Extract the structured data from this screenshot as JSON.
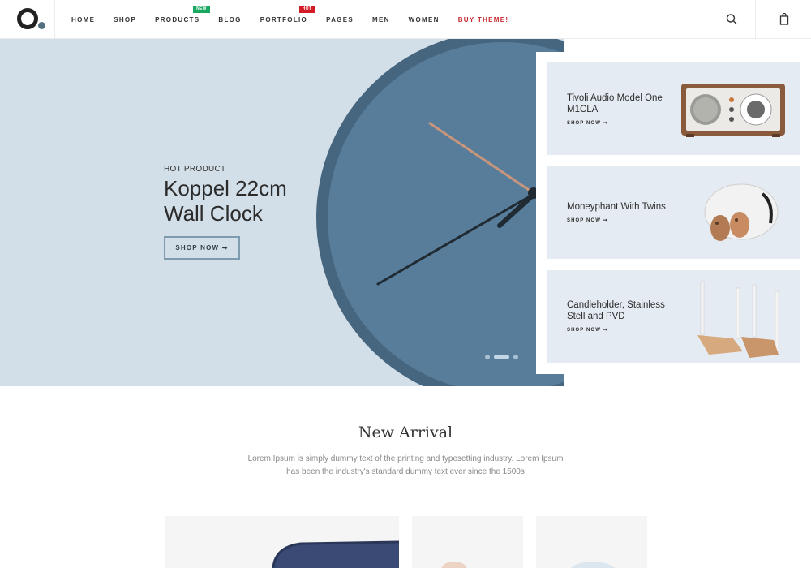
{
  "header": {
    "nav": [
      {
        "label": "HOME"
      },
      {
        "label": "SHOP"
      },
      {
        "label": "PRODUCTS",
        "badge": "NEW"
      },
      {
        "label": "BLOG"
      },
      {
        "label": "PORTFOLIO",
        "badge": "HOT"
      },
      {
        "label": "PAGES"
      },
      {
        "label": "MEN"
      },
      {
        "label": "WOMEN"
      },
      {
        "label": "BUY THEME!"
      }
    ],
    "icons": {
      "search": "search-icon",
      "cart": "shopping-bag-icon"
    }
  },
  "hero": {
    "kicker": "HOT PRODUCT",
    "title": "Koppel 22cm Wall Clock",
    "button": "SHOP NOW ➞",
    "slides": 3,
    "active_slide": 2
  },
  "side_banners": [
    {
      "title": "Tivoli Audio Model One M1CLA",
      "link": "SHOP NOW ➞"
    },
    {
      "title": "Moneyphant With Twins",
      "link": "SHOP NOW ➞"
    },
    {
      "title": "Candleholder, Stainless Stell and PVD",
      "link": "SHOP NOW ➞"
    }
  ],
  "new_arrival": {
    "title": "New Arrival",
    "description": "Lorem Ipsum is simply dummy text of the printing and typesetting industry. Lorem Ipsum has been the industry's standard dummy text ever since the 1500s"
  },
  "colors": {
    "hero_bg": "#d3dfe8",
    "clock": "#587d9b",
    "card_bg": "#e5ebf2",
    "buy_accent": "#c8282f",
    "badge_new": "#19a85f",
    "badge_hot": "#d21b24"
  }
}
